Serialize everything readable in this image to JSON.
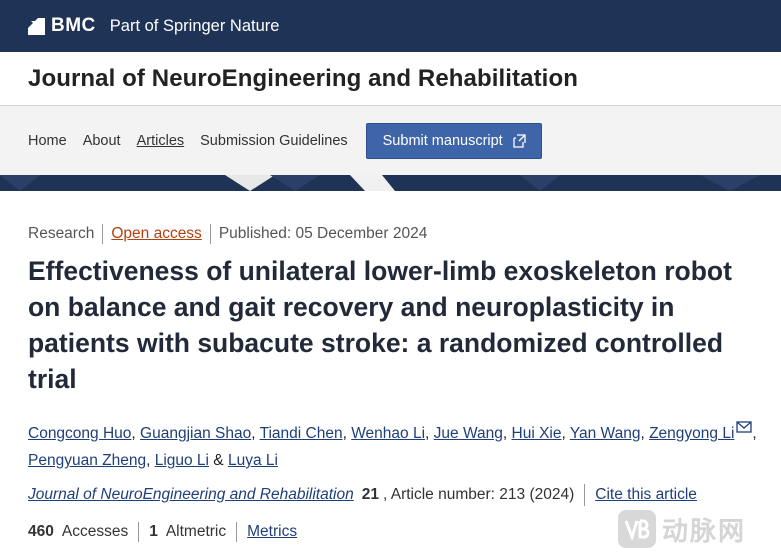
{
  "brand": {
    "logo_text": "BMC",
    "tagline": "Part of Springer Nature"
  },
  "journal": {
    "title": "Journal of NeuroEngineering and Rehabilitation"
  },
  "nav": {
    "items": [
      {
        "label": "Home"
      },
      {
        "label": "About"
      },
      {
        "label": "Articles",
        "active": true
      },
      {
        "label": "Submission Guidelines"
      }
    ],
    "submit_label": "Submit manuscript"
  },
  "article": {
    "type": "Research",
    "access": "Open access",
    "published": "Published: 05 December 2024",
    "title": "Effectiveness of unilateral lower-limb exoskeleton robot on balance and gait recovery and neuroplasticity in patients with subacute stroke: a randomized controlled trial",
    "authors": [
      "Congcong Huo",
      "Guangjian Shao",
      "Tiandi Chen",
      "Wenhao Li",
      "Jue Wang",
      "Hui Xie",
      "Yan Wang",
      "Zengyong Li",
      "Pengyuan Zheng",
      "Liguo Li",
      "Luya Li"
    ],
    "citation": {
      "journal": "Journal of NeuroEngineering and Rehabilitation",
      "volume": "21",
      "details": ", Article number: 213 (2024)",
      "cite_label": "Cite this article"
    },
    "metrics": {
      "accesses_count": "460",
      "accesses_label": "Accesses",
      "altmetric_count": "1",
      "altmetric_label": "Altmetric",
      "metrics_label": "Metrics"
    }
  },
  "watermark": {
    "text": "动脉网",
    "badge": "VB"
  },
  "colors": {
    "brand_bar": "#1f3356",
    "nav_bg": "#f3f3f3",
    "submit_button": "#3d65a8",
    "open_access": "#b5400f",
    "link": "#1f3f7a"
  }
}
